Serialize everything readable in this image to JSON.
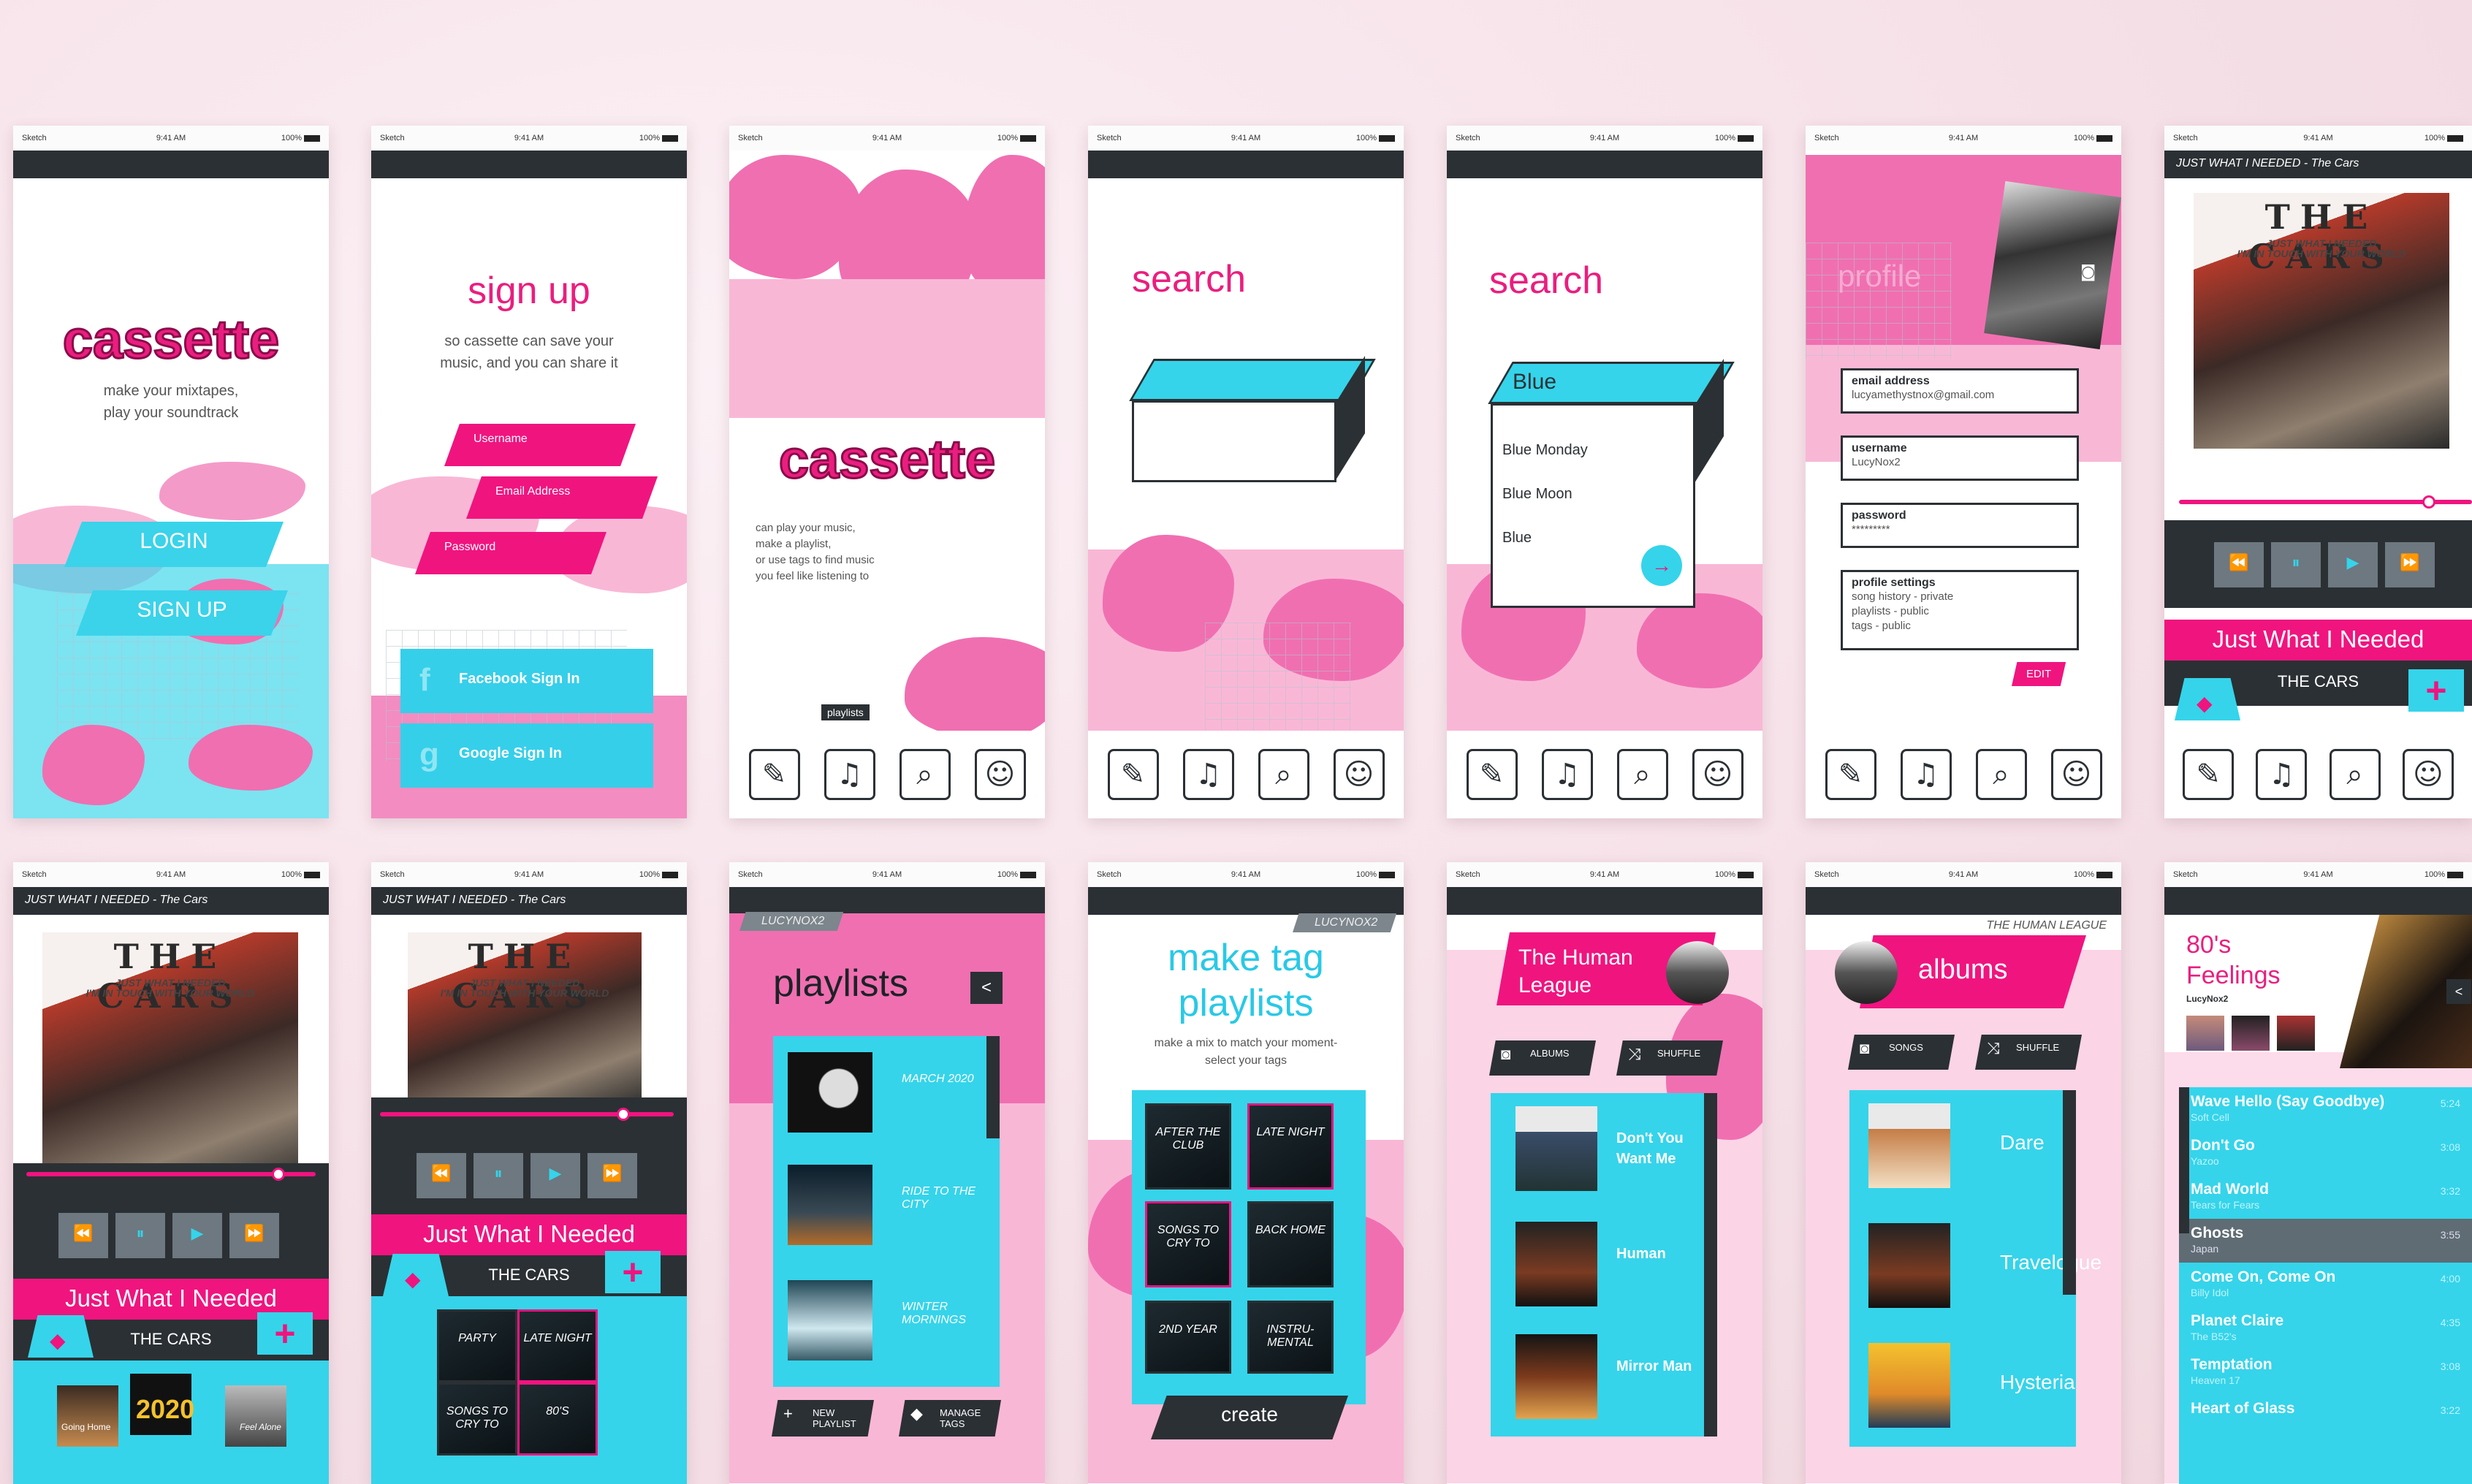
{
  "status_bar": {
    "carrier": "Sketch",
    "time": "9:41 AM",
    "battery": "100%"
  },
  "nav_icons": [
    "tag-icon",
    "playlist-icon",
    "search-icon",
    "profile-icon"
  ],
  "colors": {
    "pink": "#ea1e7f",
    "cyan": "#35d4ea",
    "dark": "#2b3034"
  },
  "welcome": {
    "logo": "cassette",
    "tagline_1": "make your mixtapes,",
    "tagline_2": "play your soundtrack",
    "login": "LOGIN",
    "signup": "SIGN UP"
  },
  "signup": {
    "title": "sign up",
    "subtitle_1": "so cassette can save your",
    "subtitle_2": "music, and you can share it",
    "username_ph": "Username",
    "email_ph": "Email Address",
    "password_ph": "Password",
    "facebook": "Facebook Sign In",
    "facebook_icon": "f",
    "google": "Google Sign In",
    "google_icon": "g"
  },
  "intro": {
    "logo": "cassette",
    "desc_1": "can play your music,",
    "desc_2": "make a playlist,",
    "desc_3": "or use tags to find music",
    "desc_4": "you feel like listening to",
    "tooltip": "playlists"
  },
  "search_empty": {
    "title": "search"
  },
  "search_results": {
    "title": "search",
    "query": "Blue",
    "results": [
      "Blue Monday",
      "Blue Moon",
      "Blue"
    ]
  },
  "profile": {
    "title": "profile",
    "email_label": "email address",
    "email_value": "lucyamethystnox@gmail.com",
    "username_label": "username",
    "username_value": "LucyNox2",
    "password_label": "password",
    "password_value": "*********",
    "settings_label": "profile settings",
    "settings_1": "song history - private",
    "settings_2": "playlists - public",
    "settings_3": "tags - public",
    "edit": "EDIT"
  },
  "player": {
    "header": "JUST WHAT I NEEDED - The Cars",
    "album_title": "THE CARS",
    "album_sub_1": "JUST WHAT I NEEDED",
    "album_sub_2": "I'M IN TOUCH WITH YOUR WORLD",
    "song": "Just What I Needed",
    "artist": "THE CARS",
    "progress": 0.93,
    "controls": [
      "⏪",
      "⏸",
      "▶",
      "⏩"
    ],
    "tag_thumbs": [
      "Going Home",
      "2020",
      "Feel Alone"
    ],
    "tag_grid": [
      "PARTY",
      "LATE NIGHT",
      "SONGS TO CRY TO",
      "80'S"
    ]
  },
  "playlists": {
    "user": "LUCYNOX2",
    "title": "playlists",
    "items": [
      "MARCH 2020",
      "RIDE TO THE CITY",
      "WINTER MORNINGS"
    ],
    "new": "NEW PLAYLIST",
    "manage": "MANAGE TAGS"
  },
  "tag_playlists": {
    "user": "LUCYNOX2",
    "title_1": "make tag",
    "title_2": "playlists",
    "subtitle_1": "make a mix to match your moment-",
    "subtitle_2": "select your tags",
    "tags": [
      "AFTER THE CLUB",
      "LATE NIGHT",
      "SONGS TO CRY TO",
      "BACK HOME",
      "2ND YEAR",
      "INSTRU-MENTAL"
    ],
    "create": "create"
  },
  "artist": {
    "name_1": "The Human",
    "name_2": "League",
    "albums_btn": "ALBUMS",
    "shuffle": "SHUFFLE",
    "songs": [
      "Don't You Want Me",
      "Human",
      "Mirror Man"
    ]
  },
  "albums": {
    "artist": "THE HUMAN LEAGUE",
    "title": "albums",
    "songs_btn": "SONGS",
    "shuffle": "SHUFFLE",
    "items": [
      "Dare",
      "Travelogue",
      "Hysteria"
    ]
  },
  "playlist80s": {
    "title_1": "80's",
    "title_2": "Feelings",
    "owner": "LucyNox2",
    "tracks": [
      {
        "name": "Wave Hello (Say Goodbye)",
        "artist": "Soft Cell",
        "time": "5:24"
      },
      {
        "name": "Don't Go",
        "artist": "Yazoo",
        "time": "3:08"
      },
      {
        "name": "Mad World",
        "artist": "Tears for Fears",
        "time": "3:32"
      },
      {
        "name": "Ghosts",
        "artist": "Japan",
        "time": "3:55"
      },
      {
        "name": "Come On, Come On",
        "artist": "Billy Idol",
        "time": "4:00"
      },
      {
        "name": "Planet Claire",
        "artist": "The B52's",
        "time": "4:35"
      },
      {
        "name": "Temptation",
        "artist": "Heaven 17",
        "time": "3:08"
      },
      {
        "name": "Heart of Glass",
        "artist": "",
        "time": "3:22"
      }
    ]
  }
}
